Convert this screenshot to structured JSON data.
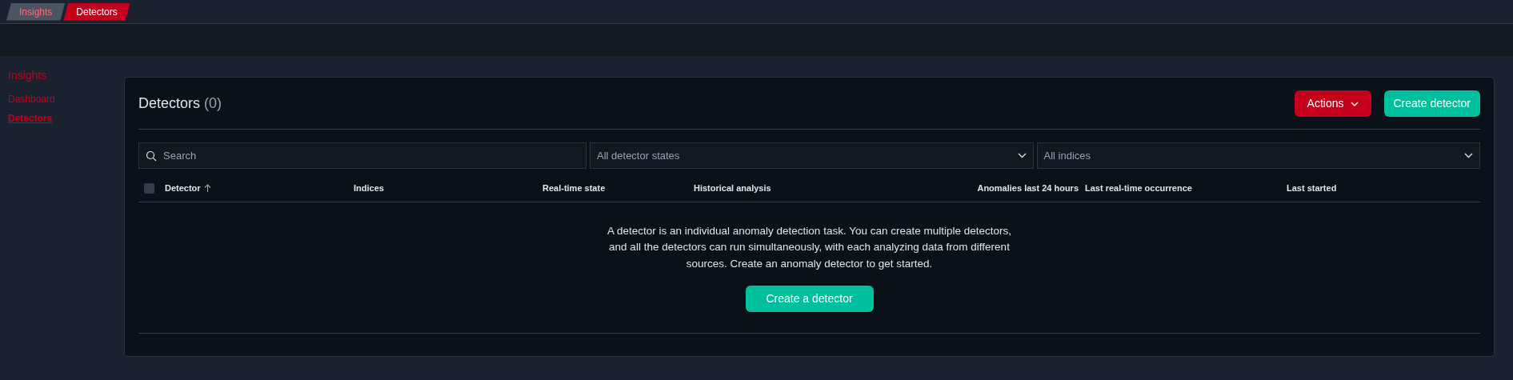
{
  "breadcrumbs": [
    {
      "label": "Insights",
      "selected": false
    },
    {
      "label": "Detectors",
      "selected": true
    }
  ],
  "sidebar": {
    "title": "Insights",
    "items": [
      {
        "label": "Dashboard",
        "selected": false
      },
      {
        "label": "Detectors",
        "selected": true
      }
    ]
  },
  "panel": {
    "title": "Detectors",
    "count": "(0)",
    "actions_button": "Actions",
    "create_button": "Create detector",
    "search": {
      "placeholder": "Search"
    },
    "filters": [
      {
        "placeholder": "All detector states"
      },
      {
        "placeholder": "All indices"
      }
    ],
    "table": {
      "select_all_checked": false,
      "columns": [
        {
          "label": "Detector",
          "sorted": true
        },
        {
          "label": "Indices",
          "sorted": false
        },
        {
          "label": "Real-time state",
          "sorted": false
        },
        {
          "label": "Historical analysis",
          "sorted": false
        },
        {
          "label": "Anomalies last 24 hours",
          "sorted": false
        },
        {
          "label": "Last real-time occurrence",
          "sorted": false
        },
        {
          "label": "Last started",
          "sorted": false
        }
      ]
    },
    "empty": {
      "message": "A detector is an individual anomaly detection task. You can create multiple detectors, and all the detectors can run simultaneously, with each analyzing data from different sources. Create an anomaly detector to get started.",
      "button": "Create a detector"
    }
  }
}
